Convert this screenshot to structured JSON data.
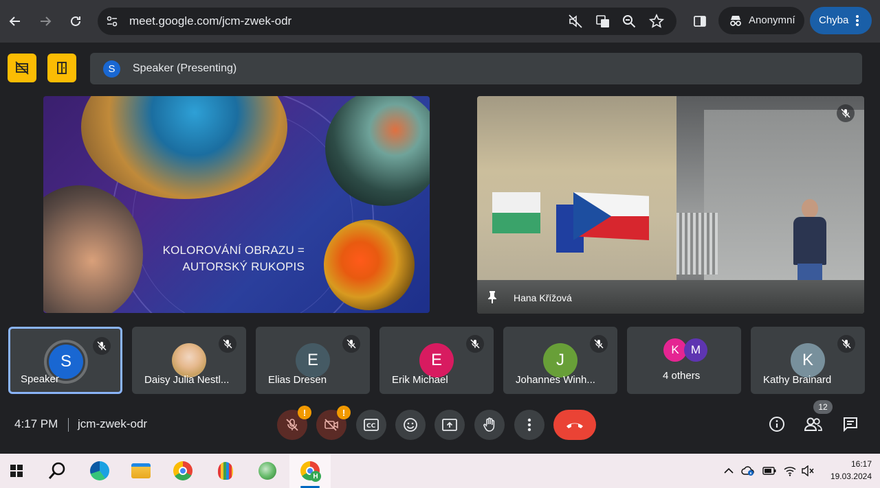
{
  "browser": {
    "url": "meet.google.com/jcm-zwek-odr",
    "profile_label": "Anonymní",
    "error_label": "Chyba"
  },
  "meet": {
    "presenting_avatar": "S",
    "presenting_label": "Speaker (Presenting)",
    "slide": {
      "line1": "KOLOROVÁNÍ OBRAZU =",
      "line2": "AUTORSKÝ RUKOPIS"
    },
    "camera_tile_name": "Hana Křížová",
    "participants": [
      {
        "initial": "S",
        "name": "Speaker",
        "color": "#1967d2"
      },
      {
        "initial": "",
        "name": "Daisy Julia Nestl...",
        "color": "#c9a37a"
      },
      {
        "initial": "E",
        "name": "Elias Dresen",
        "color": "#455a64"
      },
      {
        "initial": "E",
        "name": "Erik Michael",
        "color": "#d81b60"
      },
      {
        "initial": "J",
        "name": "Johannes Winh...",
        "color": "#689f38"
      },
      {
        "initial": "",
        "name": "4 others",
        "color": "#3c4043"
      },
      {
        "initial": "K",
        "name": "Kathy Brainard",
        "color": "#78909c"
      }
    ],
    "others_avatars": [
      {
        "initial": "K",
        "color": "#e52592"
      },
      {
        "initial": "M",
        "color": "#5e35b1"
      }
    ],
    "time": "4:17 PM",
    "meeting_code": "jcm-zwek-odr",
    "mic_badge": "!",
    "cam_badge": "!",
    "participant_count": "12"
  },
  "taskbar": {
    "time": "16:17",
    "date": "19.03.2024"
  }
}
